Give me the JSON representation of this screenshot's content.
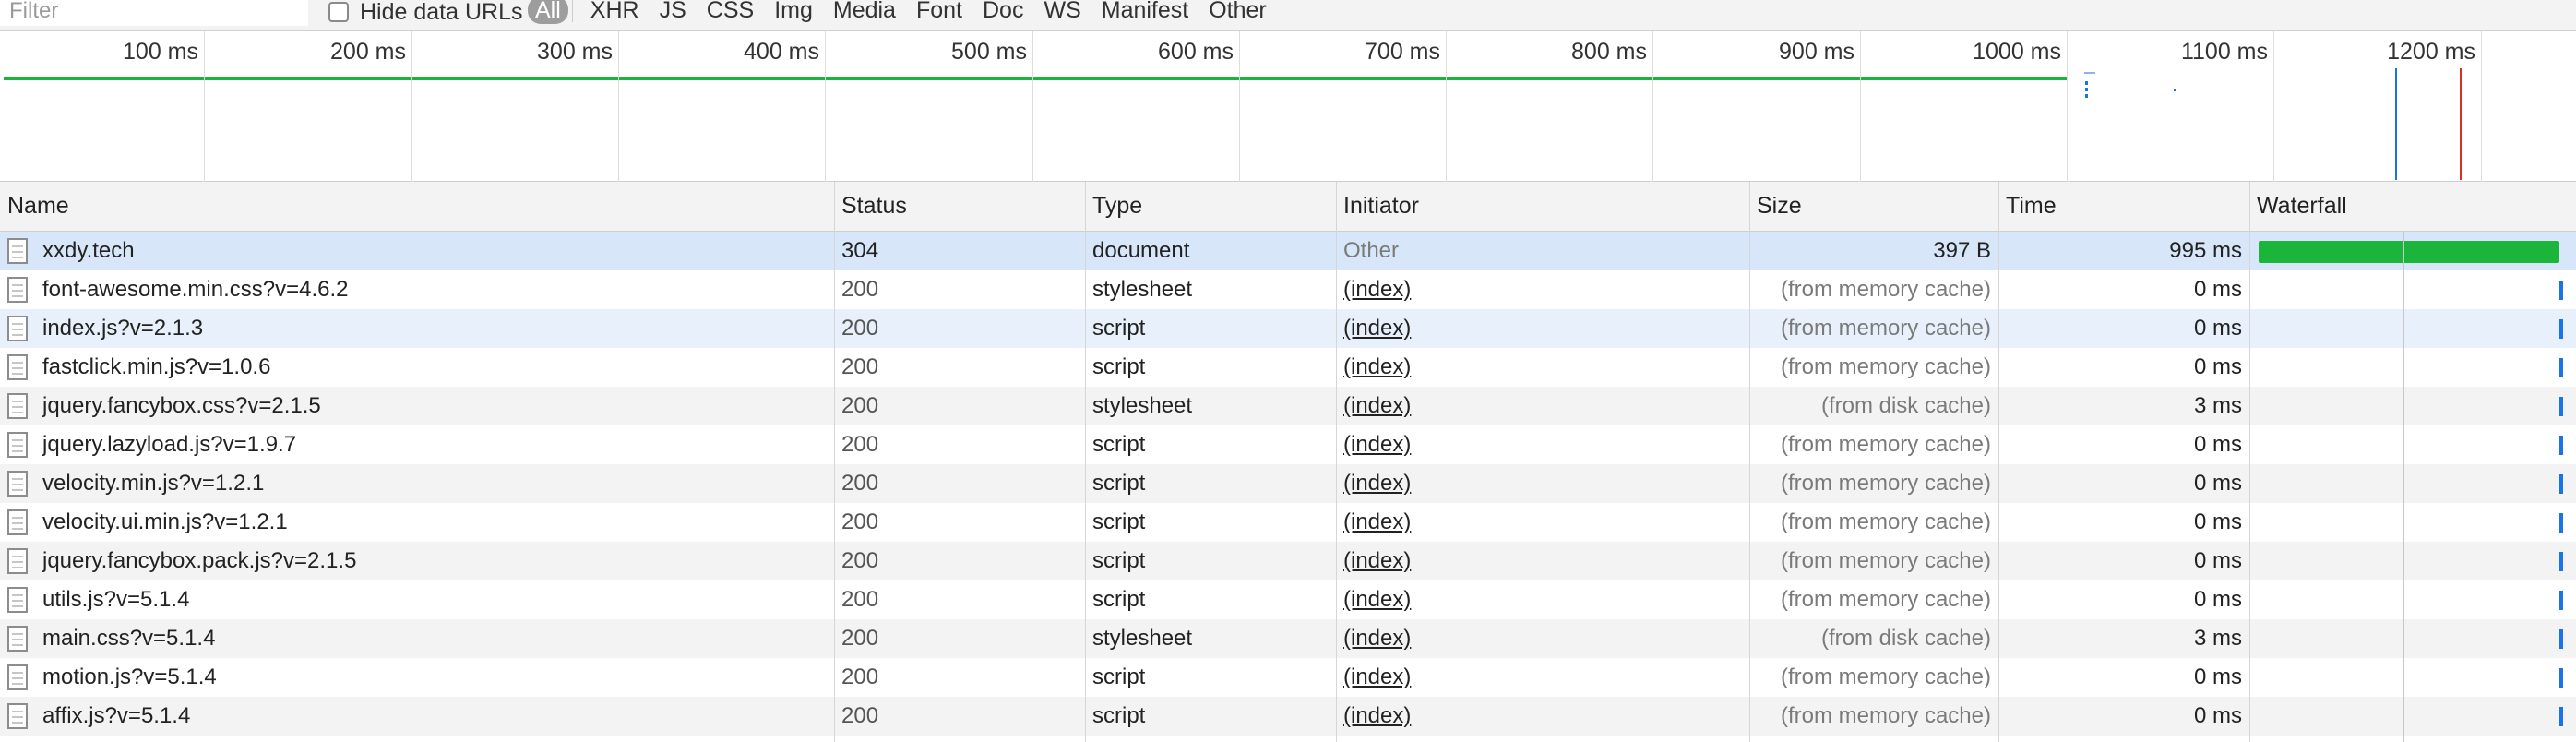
{
  "filter_bar": {
    "filter_placeholder": "Filter",
    "hide_data_urls_label": "Hide data URLs",
    "type_filters": [
      "All",
      "XHR",
      "JS",
      "CSS",
      "Img",
      "Media",
      "Font",
      "Doc",
      "WS",
      "Manifest",
      "Other"
    ],
    "active_filter": "All"
  },
  "overview": {
    "ticks": [
      "100 ms",
      "200 ms",
      "300 ms",
      "400 ms",
      "500 ms",
      "600 ms",
      "700 ms",
      "800 ms",
      "900 ms",
      "1000 ms",
      "1100 ms",
      "1200 ms"
    ],
    "colors": {
      "receiving": "#1cb53c",
      "dom_content_loaded": "#1a73e8",
      "load": "#d93025"
    }
  },
  "table": {
    "headers": {
      "name": "Name",
      "status": "Status",
      "type": "Type",
      "initiator": "Initiator",
      "size": "Size",
      "time": "Time",
      "waterfall": "Waterfall"
    },
    "rows": [
      {
        "name": "xxdy.tech",
        "status": "304",
        "type": "document",
        "initiator": "Other",
        "size": "397 B",
        "time": "995 ms"
      },
      {
        "name": "font-awesome.min.css?v=4.6.2",
        "status": "200",
        "type": "stylesheet",
        "initiator": "(index)",
        "size": "(from memory cache)",
        "time": "0 ms"
      },
      {
        "name": "index.js?v=2.1.3",
        "status": "200",
        "type": "script",
        "initiator": "(index)",
        "size": "(from memory cache)",
        "time": "0 ms"
      },
      {
        "name": "fastclick.min.js?v=1.0.6",
        "status": "200",
        "type": "script",
        "initiator": "(index)",
        "size": "(from memory cache)",
        "time": "0 ms"
      },
      {
        "name": "jquery.fancybox.css?v=2.1.5",
        "status": "200",
        "type": "stylesheet",
        "initiator": "(index)",
        "size": "(from disk cache)",
        "time": "3 ms"
      },
      {
        "name": "jquery.lazyload.js?v=1.9.7",
        "status": "200",
        "type": "script",
        "initiator": "(index)",
        "size": "(from memory cache)",
        "time": "0 ms"
      },
      {
        "name": "velocity.min.js?v=1.2.1",
        "status": "200",
        "type": "script",
        "initiator": "(index)",
        "size": "(from memory cache)",
        "time": "0 ms"
      },
      {
        "name": "velocity.ui.min.js?v=1.2.1",
        "status": "200",
        "type": "script",
        "initiator": "(index)",
        "size": "(from memory cache)",
        "time": "0 ms"
      },
      {
        "name": "jquery.fancybox.pack.js?v=2.1.5",
        "status": "200",
        "type": "script",
        "initiator": "(index)",
        "size": "(from memory cache)",
        "time": "0 ms"
      },
      {
        "name": "utils.js?v=5.1.4",
        "status": "200",
        "type": "script",
        "initiator": "(index)",
        "size": "(from memory cache)",
        "time": "0 ms"
      },
      {
        "name": "main.css?v=5.1.4",
        "status": "200",
        "type": "stylesheet",
        "initiator": "(index)",
        "size": "(from disk cache)",
        "time": "3 ms"
      },
      {
        "name": "motion.js?v=5.1.4",
        "status": "200",
        "type": "script",
        "initiator": "(index)",
        "size": "(from memory cache)",
        "time": "0 ms"
      },
      {
        "name": "affix.js?v=5.1.4",
        "status": "200",
        "type": "script",
        "initiator": "(index)",
        "size": "(from memory cache)",
        "time": "0 ms"
      }
    ]
  }
}
